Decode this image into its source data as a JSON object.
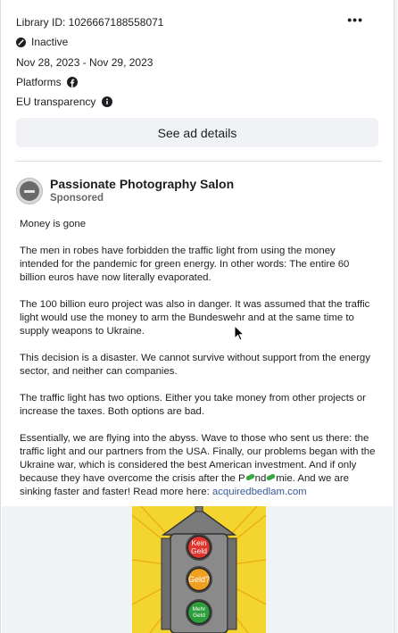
{
  "library_id": "Library ID: 1026667188558071",
  "status": "Inactive",
  "dates": "Nov 28, 2023 - Nov 29, 2023",
  "platforms_label": "Platforms",
  "eu_label": "EU transparency",
  "more_label": "•••",
  "see_details_label": "See ad details",
  "advertiser": {
    "name": "Passionate Photography Salon",
    "sponsored": "Sponsored"
  },
  "ad_text": {
    "p1": "Money is gone",
    "p2": "The men in robes have forbidden the traffic light from using the money intended for the pandemic for green energy. In other words: The entire 60 billion euros have now literally evaporated.",
    "p3": "The 100 billion euro project was also in danger. It was assumed that the traffic light would use the money to arm the Bundeswehr and at the same time to supply weapons to Ukraine.",
    "p4": "This decision is a disaster. We cannot survive without support from the energy sector, and neither can companies.",
    "p5": "The traffic light has two options. Either you take money from other projects or increase the taxes. Both options are bad.",
    "p6_before": "Essentially, we are flying into the abyss. Wave to those who sent us there: the traffic light and our partners from the USA. Finally, our problems began with the Ukraine war, which is considered the best American investment. And if only because they have overcome the crisis after the P",
    "p6_mid1": "nd",
    "p6_mid2": "mie. And we are sinking faster and faster! Read more here: ",
    "link": "acquiredbedlam.com"
  },
  "image_text": {
    "red": "Kein Geld",
    "yellow": "Geld?",
    "green": "Mehr Geld"
  },
  "colors": {
    "link": "#385898",
    "traffic_bg": "#f4d530",
    "red": "#e0342d",
    "amber": "#f0a020",
    "green": "#2e9e3c"
  }
}
